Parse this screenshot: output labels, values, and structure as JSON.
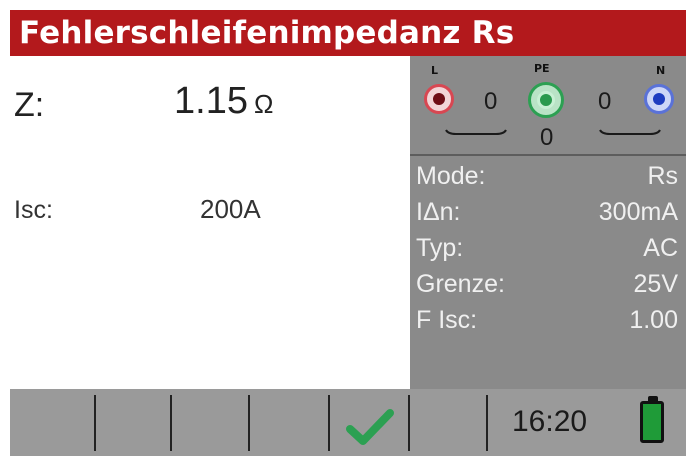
{
  "title": "Fehlerschleifenimpedanz Rs",
  "measurement": {
    "z_label": "Z:",
    "z_value": "1.15",
    "z_unit": "Ω",
    "isc_label": "Isc:",
    "isc_value": "200A"
  },
  "terminals": {
    "l_label": "L",
    "pe_label": "PE",
    "n_label": "N",
    "l_pe_value": "0",
    "pe_n_value": "0",
    "l_n_value": "0",
    "colors": {
      "l": "#d84752",
      "pe": "#2ca052",
      "n": "#5a72d8"
    }
  },
  "params": [
    {
      "key": "Mode:",
      "value": "Rs"
    },
    {
      "key": "IΔn:",
      "value": "300mA"
    },
    {
      "key": "Typ:",
      "value": "AC"
    },
    {
      "key": "Grenze:",
      "value": "25V"
    },
    {
      "key": "F Isc:",
      "value": "1.00"
    }
  ],
  "statusbar": {
    "time": "16:20",
    "check_icon": "check-icon",
    "battery_icon": "battery-full-icon",
    "battery_level": 1.0
  },
  "colors": {
    "title_bg": "#b3191c",
    "panel_bg": "#8a8a8a",
    "check": "#2ca052",
    "battery": "#1f9b38"
  }
}
